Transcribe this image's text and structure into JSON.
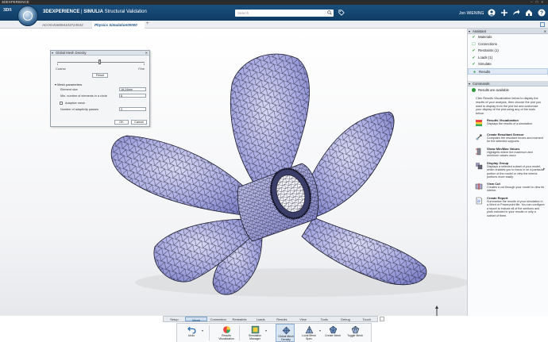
{
  "os_title": "3DEXPERIENCE",
  "app": {
    "brand": "3DEXPERIENCE",
    "product": "SIMULIA",
    "app_name": "Structural Validation",
    "search_placeholder": "Search",
    "user_name": "Jon WIENING"
  },
  "tabs": {
    "tab1": "ACOG4U6084103724533",
    "tab2": "Physics Simulation00000",
    "add": "+"
  },
  "mesh_dialog": {
    "title": "Global Mesh Density",
    "coarse": "Coarse",
    "fine": "Fine",
    "reset": "Reset",
    "mesh_params": "Mesh parameters",
    "element_size_lbl": "Element size",
    "element_size_val": "18.24mm",
    "min_elements_lbl": "Min. number of elements in a circle",
    "min_elements_val": "8",
    "adaptive_lbl": "Adaptive mesh",
    "adaptive_passes_lbl": "Number of adaptivity passes",
    "adaptive_passes_val": "3",
    "ok": "OK",
    "cancel": "Cancel"
  },
  "assistant": {
    "title": "Assistant",
    "items": [
      {
        "label": "Materials",
        "status": "done"
      },
      {
        "label": "Connections",
        "status": "todo"
      },
      {
        "label": "Restraints (1)",
        "status": "done"
      },
      {
        "label": "Loads (1)",
        "status": "done"
      },
      {
        "label": "Simulate",
        "status": "done"
      },
      {
        "label": "Results",
        "status": "active"
      }
    ]
  },
  "commands": {
    "title": "Commands",
    "results_available": "Results are available",
    "intro": "Click Results Visualization below to display the results of your analysis, then choose the plot you want to display from the plot list and customize your display of the plot using any of the tools below.",
    "items": [
      {
        "title": "Results Visualization",
        "desc": "Displays the results of a simulation."
      },
      {
        "title": "Create Resultant Sensor",
        "desc": "Computes the resultant forces and moment for the selected supports."
      },
      {
        "title": "Show Min/Max Values",
        "desc": "Highlights where the maximum and minimum values occur."
      },
      {
        "title": "Display Group",
        "desc": "Displays a selected subset of your model, which enables you to focus in on a particular portion of the model or view the interior portions more easily."
      },
      {
        "title": "View Cut",
        "desc": "Creates a cut through your model to view its interior."
      },
      {
        "title": "Create Report",
        "desc": "Summarize the results of your simulation in a Word or Powerpoint file. You can configure a report to include all of the sections and plots included in your results or only a subset of them."
      }
    ]
  },
  "section_tabs": [
    "Setup",
    "Mesh",
    "Connection",
    "Restraints",
    "Loads",
    "Results",
    "View",
    "Tools",
    "Debug",
    "Touch"
  ],
  "active_section": "Mesh",
  "actions": {
    "undo": "Undo",
    "results_vis": "Results Visualization",
    "sim_manager": "Simulation Manager",
    "global_mesh": "Global Mesh Density",
    "local_mesh": "Local Mesh Spec",
    "create_mesh": "Create Mesh",
    "toggle_mesh": "Toggle Mesh"
  },
  "colors": {
    "topbar": "#1a4f7e",
    "mesh_fill": "#9b9ee0",
    "mesh_line": "#1b1b2a",
    "status_green": "#2a9a3a"
  }
}
